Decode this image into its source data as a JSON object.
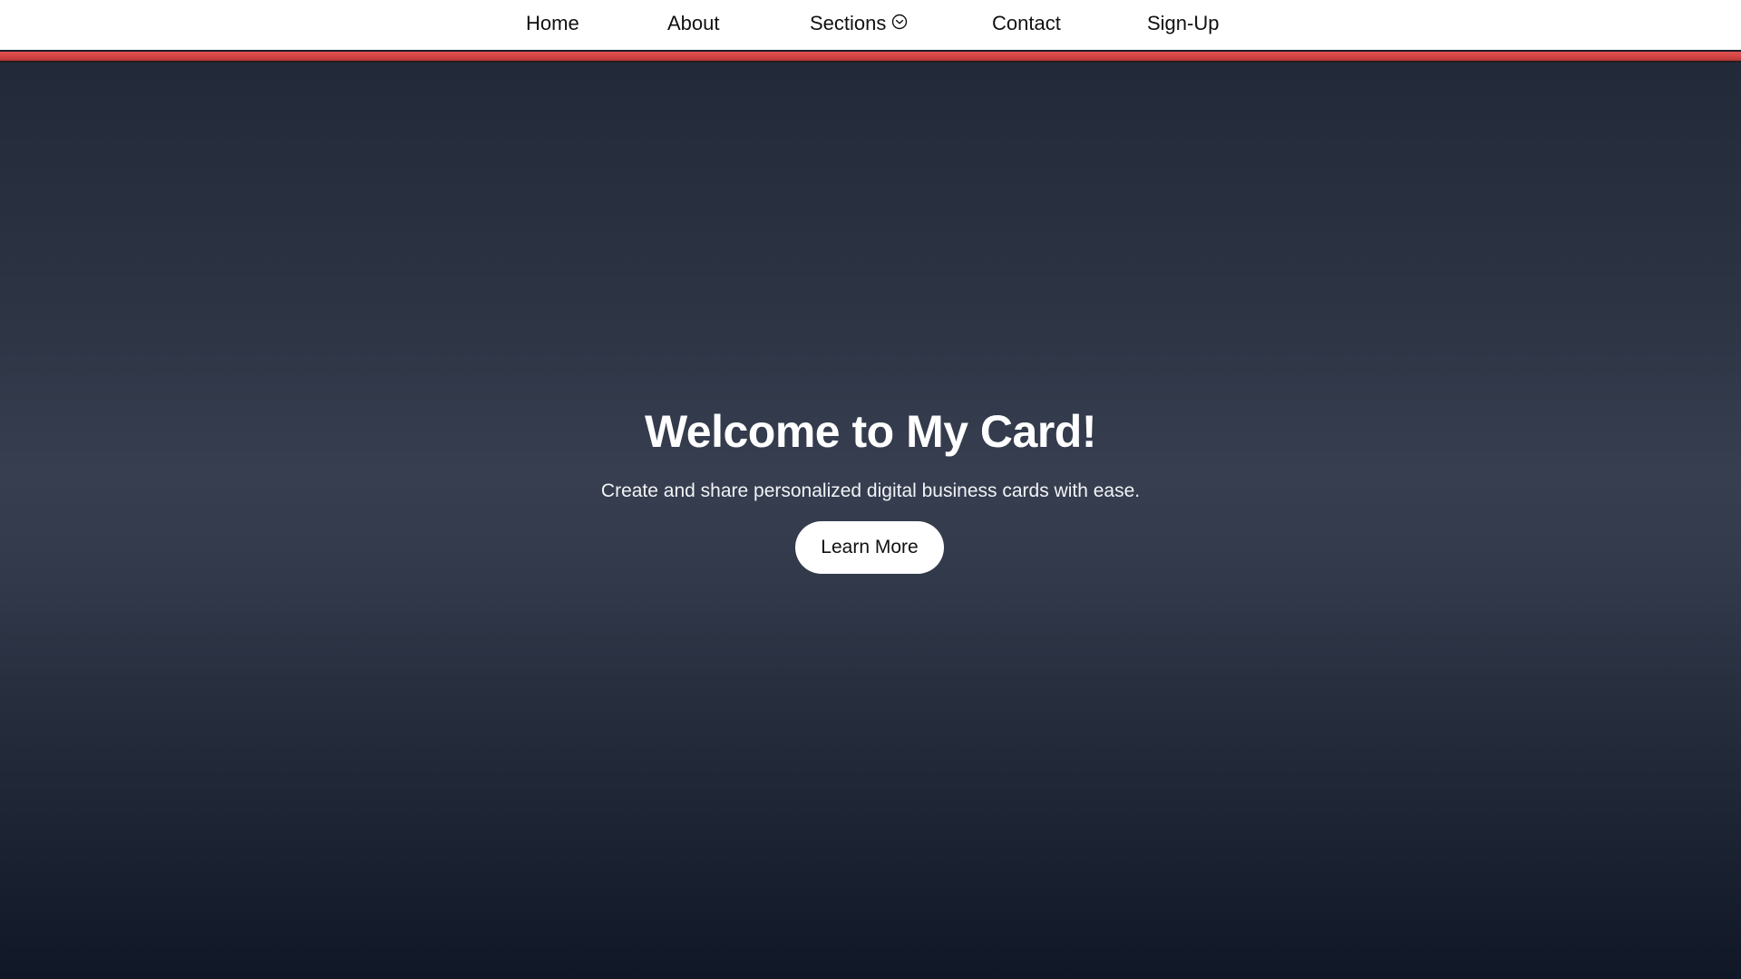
{
  "nav": {
    "items": [
      {
        "label": "Home"
      },
      {
        "label": "About"
      },
      {
        "label": "Sections",
        "icon": "chevron-down-circle-icon"
      },
      {
        "label": "Contact"
      },
      {
        "label": "Sign-Up"
      }
    ]
  },
  "hero": {
    "title": "Welcome to My Card!",
    "subtitle": "Create and share personalized digital business cards with ease.",
    "button_label": "Learn More"
  },
  "colors": {
    "nav_background": "#ffffff",
    "accent_band": "#d54646",
    "hero_top": "#222a39",
    "hero_middle": "#363e50",
    "hero_bottom": "#101727",
    "button_background": "#ffffff",
    "text_light": "#ffffff",
    "text_dark": "#111111"
  }
}
